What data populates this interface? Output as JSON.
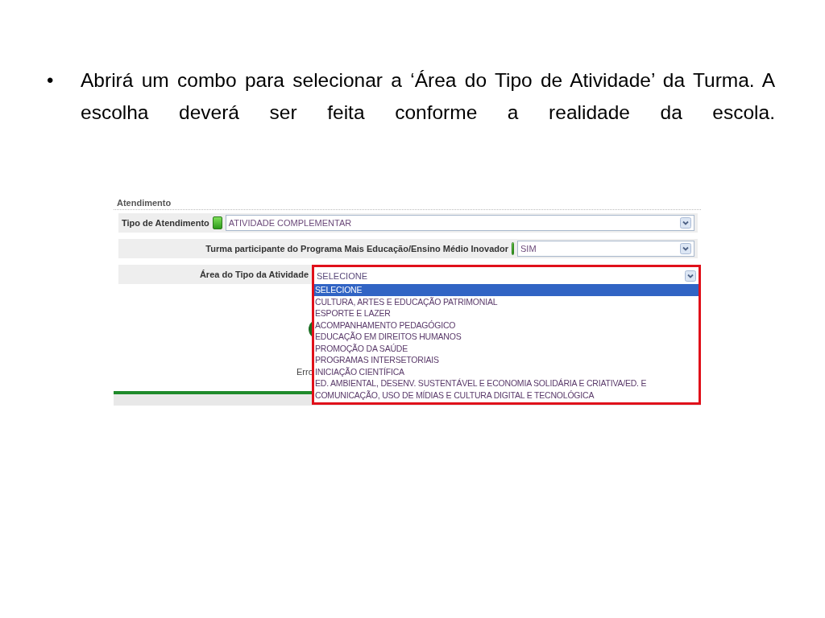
{
  "slide": {
    "bullet": "•",
    "text": "Abrirá um combo para selecionar a ‘Área do Tipo de Atividade’ da Turma. A escolha deverá ser feita conforme a realidade da escola."
  },
  "form": {
    "section_title": "Atendimento",
    "fields": [
      {
        "kind": "inline",
        "label": "Tipo de Atendimento",
        "value": "ATIVIDADE COMPLEMENTAR"
      },
      {
        "kind": "right",
        "label": "Turma participante do Programa Mais Educação/Ensino Médio Inovador",
        "value": "SIM"
      }
    ],
    "dropdown": {
      "label": "Área do Tipo da Atividade",
      "value": "SELECIONE",
      "options": [
        {
          "text": "SELECIONE",
          "selected": true
        },
        {
          "text": "CULTURA, ARTES E EDUCAÇÃO PATRIMONIAL",
          "selected": false
        },
        {
          "text": "ESPORTE E LAZER",
          "selected": false
        },
        {
          "text": "ACOMPANHAMENTO PEDAGÓGICO",
          "selected": false
        },
        {
          "text": "EDUCAÇÃO EM DIREITOS HUMANOS",
          "selected": false
        },
        {
          "text": "PROMOÇÃO DA SAÚDE",
          "selected": false
        },
        {
          "text": "PROGRAMAS INTERSETORIAIS",
          "selected": false
        },
        {
          "text": "INICIAÇÃO CIENTÍFICA",
          "selected": false
        },
        {
          "text": "ED. AMBIENTAL, DESENV. SUSTENTÁVEL E ECONOMIA SOLIDÁRIA E CRIATIVA/ED. E",
          "selected": false
        },
        {
          "text": "COMUNICAÇÃO, USO DE MÍDIAS E CULTURA DIGITAL E TECNOLÓGICA",
          "selected": false
        }
      ]
    },
    "error_text": "Erro"
  }
}
